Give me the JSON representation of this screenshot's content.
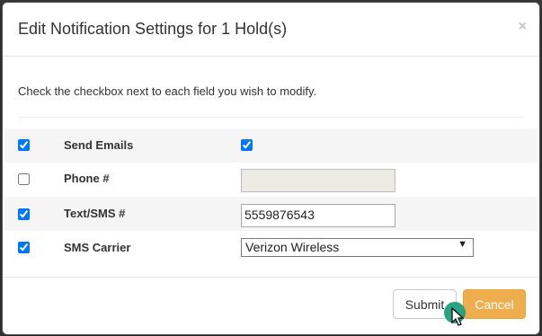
{
  "dialog": {
    "title": "Edit Notification Settings for 1 Hold(s)",
    "close_glyph": "×",
    "instruction": "Check the checkbox next to each field you wish to modify."
  },
  "fields": {
    "send_emails": {
      "label": "Send Emails",
      "modify_checked": true,
      "value_checked": true
    },
    "phone": {
      "label": "Phone #",
      "modify_checked": false,
      "value": "",
      "disabled": true
    },
    "text_sms": {
      "label": "Text/SMS #",
      "modify_checked": true,
      "value": "5559876543"
    },
    "sms_carrier": {
      "label": "SMS Carrier",
      "modify_checked": true,
      "selected": "Verizon Wireless",
      "arrow_glyph": "▼"
    }
  },
  "buttons": {
    "submit_label": "Submit",
    "cancel_label": "Cancel"
  },
  "colors": {
    "cancel_bg": "#f0ad4e",
    "cursor_highlight": "#1d9e7a"
  },
  "icons": {
    "close": "close-icon",
    "dropdown": "chevron-down-icon",
    "cursor": "mouse-pointer-icon"
  }
}
